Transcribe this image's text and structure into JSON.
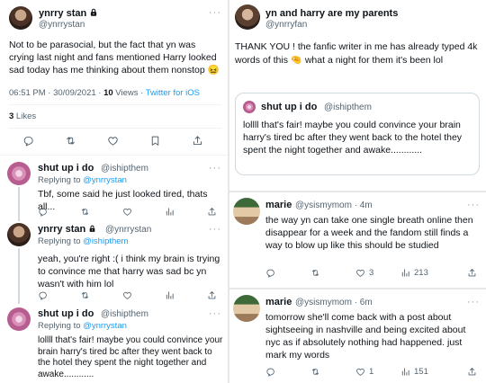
{
  "left": {
    "main_tweet": {
      "name": "ynrry stan",
      "handle": "@ynrrystan",
      "text": "Not to be parasocial, but the fact that yn was crying last night and fans mentioned Harry looked sad today has me thinking about them nonstop 😖",
      "time": "06:51 PM · 30/09/2021 · ",
      "views_count": "10",
      "views_label": " Views · ",
      "source": "Twitter for iOS",
      "likes_count": "3",
      "likes_label": " Likes"
    },
    "replies": [
      {
        "name": "shut up i do",
        "handle": "@ishipthem",
        "dots": "···",
        "replying_prefix": "Replying to ",
        "replying_to": "@ynrrystan",
        "text": "Tbf, some said he just looked tired, thats all..."
      },
      {
        "name": "ynrry stan",
        "handle": "@ynrrystan",
        "dots": "···",
        "replying_prefix": "Replying to ",
        "replying_to": "@ishipthem",
        "text": "yeah, you're right :( i think my brain is trying to convince me that harry was sad bc yn wasn't with him lol"
      },
      {
        "name": "shut up i do",
        "handle": "@ishipthem",
        "dots": "···",
        "replying_prefix": "Replying to ",
        "replying_to": "@ynrrystan",
        "text": "lollll that's fair! maybe you could convince your brain harry's tired bc after they went back to the hotel they spent the night together and awake............"
      }
    ]
  },
  "right": {
    "quote_tweet": {
      "name": "yn and harry are my parents",
      "handle": "@ynrryfan",
      "text": "THANK YOU ! the fanfic writer in me has already typed 4k words of this 🤏 what a night for them it's been lol",
      "quoted": {
        "name": "shut up i do",
        "handle": "@ishipthem",
        "text": "lollll that's fair! maybe you could convince your brain harry's tired bc after they went back to the hotel they spent the night together and awake............"
      }
    },
    "replies": [
      {
        "name": "marie",
        "handle": "@ysismymom · 4m",
        "dots": "···",
        "text": "the way yn can take one single breath online then disappear for a week and the fandom still finds a way to blow up like this should be studied",
        "likes": "3",
        "views": "213"
      },
      {
        "name": "marie",
        "handle": "@ysismymom · 6m",
        "dots": "···",
        "text": "tomorrow she'll come back with a post about sightseeing in nashville and being excited about nyc as if absolutely nothing had happened. just mark my words",
        "likes": "1",
        "views": "151"
      }
    ]
  },
  "icons": {
    "reply": "reply-icon",
    "retweet": "retweet-icon",
    "like": "like-icon",
    "bookmark": "bookmark-icon",
    "share": "share-icon",
    "views": "views-icon",
    "lock": "lock-icon"
  }
}
